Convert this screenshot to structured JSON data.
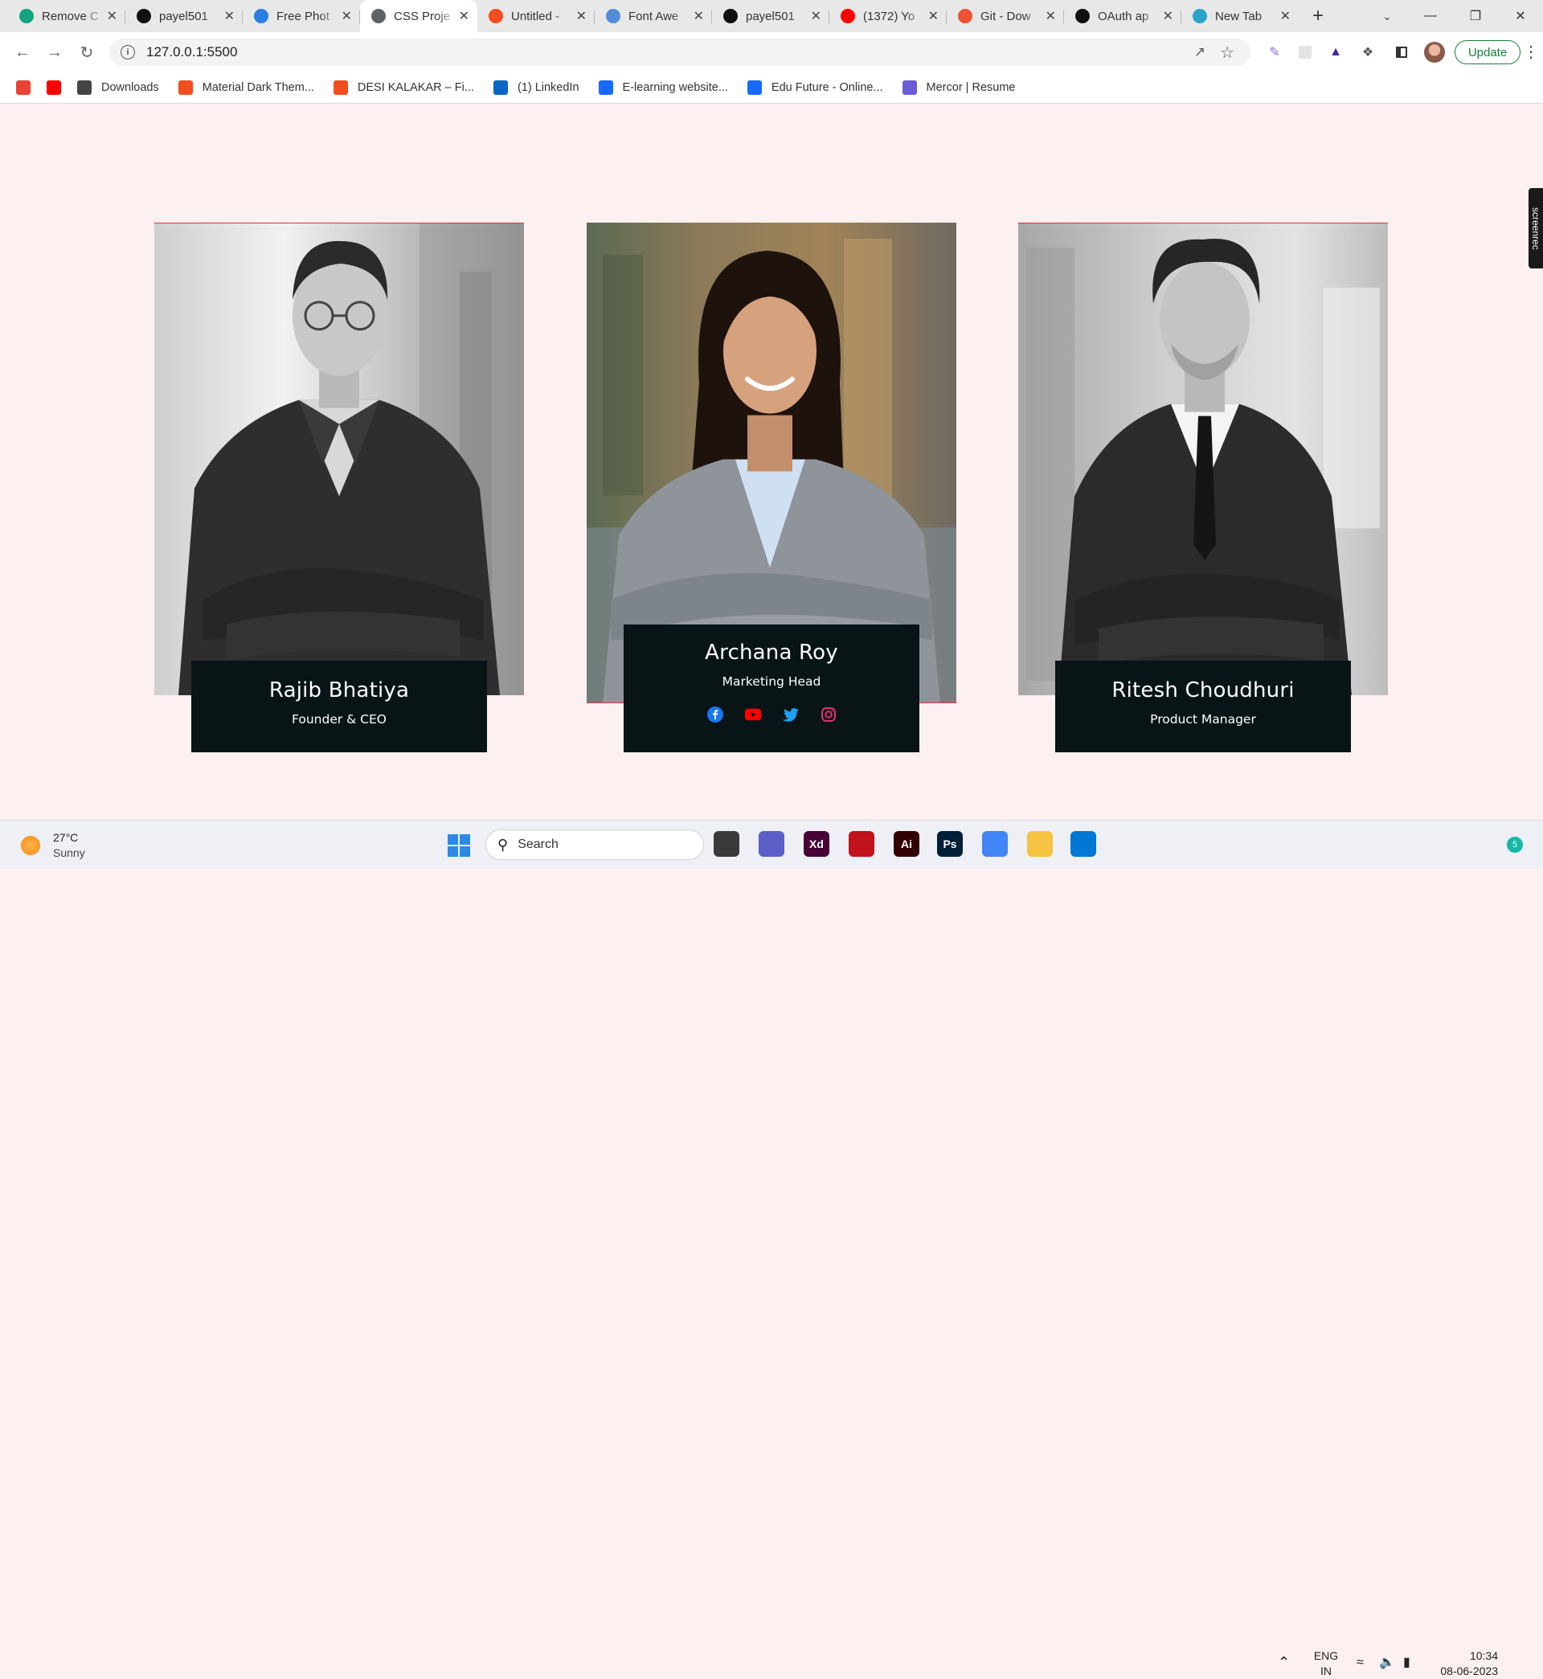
{
  "browser": {
    "tabs": [
      {
        "title": "Remove C",
        "icon": "chatgpt-icon",
        "color": "#10a37f",
        "active": false
      },
      {
        "title": "payel501",
        "icon": "github-icon",
        "color": "#111111",
        "active": false
      },
      {
        "title": "Free Phot",
        "icon": "pixabay-icon",
        "color": "#2a7de1",
        "active": false
      },
      {
        "title": "CSS Proje",
        "icon": "globe-icon",
        "color": "#5f6368",
        "active": true
      },
      {
        "title": "Untitled -",
        "icon": "figma-icon",
        "color": "#f24e1e",
        "active": false
      },
      {
        "title": "Font Awe",
        "icon": "flag-icon",
        "color": "#528dd7",
        "active": false
      },
      {
        "title": "payel501",
        "icon": "github-icon",
        "color": "#111111",
        "active": false
      },
      {
        "title": "(1372) Yo",
        "icon": "youtube-icon",
        "color": "#ff0000",
        "active": false
      },
      {
        "title": "Git - Dow",
        "icon": "git-icon",
        "color": "#f05133",
        "active": false
      },
      {
        "title": "OAuth ap",
        "icon": "github-icon",
        "color": "#111111",
        "active": false
      },
      {
        "title": "New Tab",
        "icon": "react-icon",
        "color": "#2aa3c8",
        "active": false
      }
    ],
    "new_tab_symbol": "+",
    "address": "127.0.0.1:5500",
    "update_label": "Update",
    "bookmarks": [
      {
        "label": "",
        "icon": "gmail-icon",
        "color": "#ea4335"
      },
      {
        "label": "",
        "icon": "youtube-icon",
        "color": "#ff0000"
      },
      {
        "label": "Downloads",
        "icon": "download-icon",
        "color": "#444444"
      },
      {
        "label": "Material Dark Them...",
        "icon": "figma-icon",
        "color": "#f24e1e"
      },
      {
        "label": "DESI KALAKAR – Fi...",
        "icon": "figma-icon",
        "color": "#f24e1e"
      },
      {
        "label": "(1) LinkedIn",
        "icon": "linkedin-icon",
        "color": "#0a66c2"
      },
      {
        "label": "E-learning website...",
        "icon": "behance-icon",
        "color": "#1769ff"
      },
      {
        "label": "Edu Future - Online...",
        "icon": "behance-icon",
        "color": "#1769ff"
      },
      {
        "label": "Mercor | Resume",
        "icon": "mercor-icon",
        "color": "#6b5bd6"
      }
    ]
  },
  "team": [
    {
      "name": "Rajib Bhatiya",
      "role": "Founder & CEO",
      "featured": false
    },
    {
      "name": "Archana Roy",
      "role": "Marketing Head",
      "featured": true,
      "socials": [
        {
          "icon": "facebook-icon",
          "color": "#1877f2"
        },
        {
          "icon": "youtube-icon",
          "color": "#ff0000"
        },
        {
          "icon": "twitter-icon",
          "color": "#1da1f2"
        },
        {
          "icon": "instagram-icon",
          "color": "#e1306c"
        }
      ]
    },
    {
      "name": "Ritesh Choudhuri",
      "role": "Product Manager",
      "featured": false
    }
  ],
  "screenrec_label": "screenrec",
  "taskbar": {
    "temperature": "27°C",
    "condition": "Sunny",
    "search_label": "Search",
    "apps": [
      {
        "icon": "task-view-icon",
        "color": "#3a3a3a",
        "text": ""
      },
      {
        "icon": "teams-chat-icon",
        "color": "#5b5fc7",
        "text": ""
      },
      {
        "icon": "adobe-xd-icon",
        "color": "#470137",
        "text": "Xd"
      },
      {
        "icon": "red-app-icon",
        "color": "#c0131b",
        "text": ""
      },
      {
        "icon": "illustrator-icon",
        "color": "#330000",
        "text": "Ai"
      },
      {
        "icon": "photoshop-icon",
        "color": "#001e36",
        "text": "Ps"
      },
      {
        "icon": "chrome-icon",
        "color": "#4285f4",
        "text": ""
      },
      {
        "icon": "file-explorer-icon",
        "color": "#f6c343",
        "text": ""
      },
      {
        "icon": "vscode-icon",
        "color": "#0078d4",
        "text": ""
      }
    ],
    "language": "ENG",
    "region": "IN",
    "time": "10:34",
    "date": "08-06-2023",
    "notifications": "5"
  }
}
